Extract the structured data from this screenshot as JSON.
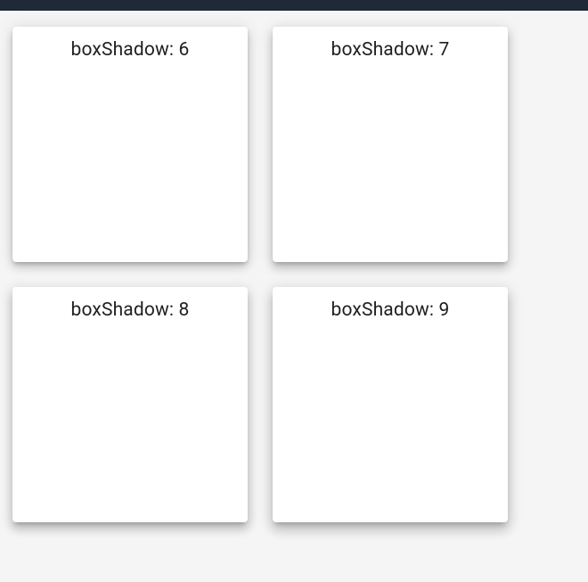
{
  "cards": [
    {
      "label": "boxShadow: 6",
      "elevation": 6
    },
    {
      "label": "boxShadow: 7",
      "elevation": 7
    },
    {
      "label": "boxShadow: 8",
      "elevation": 8
    },
    {
      "label": "boxShadow: 9",
      "elevation": 9
    }
  ]
}
